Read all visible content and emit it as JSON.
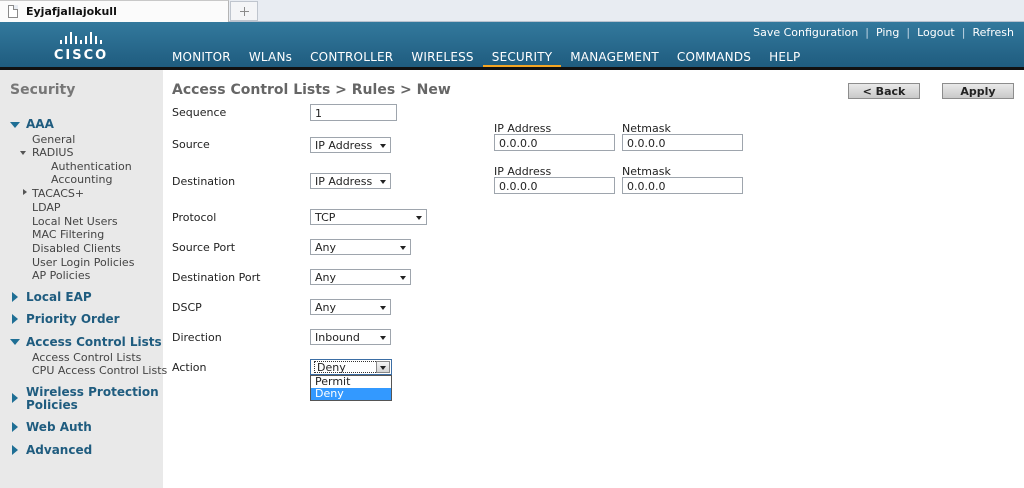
{
  "browser": {
    "tab_title": "Eyjafjallajokull",
    "new_tab_icon": "plus-icon"
  },
  "header": {
    "logo_text": "CISCO",
    "top_links": [
      "Save Configuration",
      "Ping",
      "Logout",
      "Refresh"
    ],
    "nav": [
      "MONITOR",
      "WLANs",
      "CONTROLLER",
      "WIRELESS",
      "SECURITY",
      "MANAGEMENT",
      "COMMANDS",
      "HELP"
    ],
    "active_nav": "SECURITY",
    "accent_color": "#f5a623"
  },
  "sidebar": {
    "title": "Security",
    "aaa": "AAA",
    "general": "General",
    "radius": "RADIUS",
    "authentication": "Authentication",
    "accounting": "Accounting",
    "tacacs": "TACACS+",
    "ldap": "LDAP",
    "local_net_users": "Local Net Users",
    "mac_filtering": "MAC Filtering",
    "disabled_clients": "Disabled Clients",
    "user_login_policies": "User Login Policies",
    "ap_policies": "AP Policies",
    "local_eap": "Local EAP",
    "priority_order": "Priority Order",
    "acl": "Access Control Lists",
    "acl_sub1": "Access Control Lists",
    "acl_sub2": "CPU Access Control Lists",
    "wpp_line1": "Wireless Protection",
    "wpp_line2": "Policies",
    "web_auth": "Web Auth",
    "advanced": "Advanced"
  },
  "page": {
    "title": "Access Control Lists > Rules > New",
    "back_button": "< Back",
    "apply_button": "Apply"
  },
  "form": {
    "sequence_label": "Sequence",
    "sequence_value": "1",
    "source_label": "Source",
    "source_type": "IP Address",
    "source_ip_label": "IP Address",
    "source_ip": "0.0.0.0",
    "source_mask_label": "Netmask",
    "source_mask": "0.0.0.0",
    "destination_label": "Destination",
    "destination_type": "IP Address",
    "dest_ip_label": "IP Address",
    "dest_ip": "0.0.0.0",
    "dest_mask_label": "Netmask",
    "dest_mask": "0.0.0.0",
    "protocol_label": "Protocol",
    "protocol": "TCP",
    "source_port_label": "Source Port",
    "source_port": "Any",
    "dest_port_label": "Destination Port",
    "dest_port": "Any",
    "dscp_label": "DSCP",
    "dscp": "Any",
    "direction_label": "Direction",
    "direction": "Inbound",
    "action_label": "Action",
    "action": "Deny",
    "action_options": [
      "Permit",
      "Deny"
    ]
  }
}
